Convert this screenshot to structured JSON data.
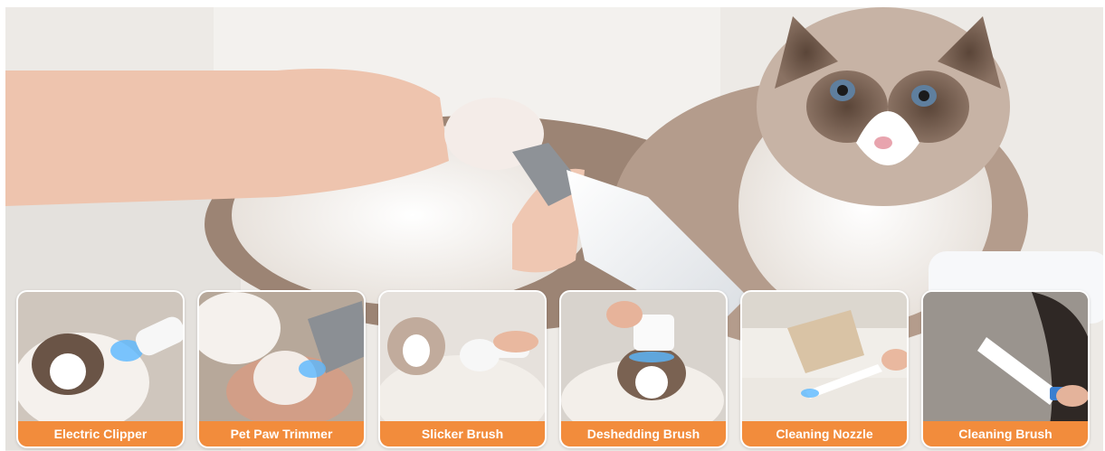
{
  "colors": {
    "label_bg": "#f28c3c",
    "label_text": "#ffffff",
    "accent_glow": "#3aa8ff"
  },
  "cards": [
    {
      "label": "Electric Clipper",
      "icon": "electric-clipper-photo"
    },
    {
      "label": "Pet Paw Trimmer",
      "icon": "paw-trimmer-photo"
    },
    {
      "label": "Slicker Brush",
      "icon": "slicker-brush-photo"
    },
    {
      "label": "Deshedding Brush",
      "icon": "deshedding-brush-photo"
    },
    {
      "label": "Cleaning Nozzle",
      "icon": "cleaning-nozzle-photo"
    },
    {
      "label": "Cleaning Brush",
      "icon": "cleaning-brush-photo"
    }
  ]
}
